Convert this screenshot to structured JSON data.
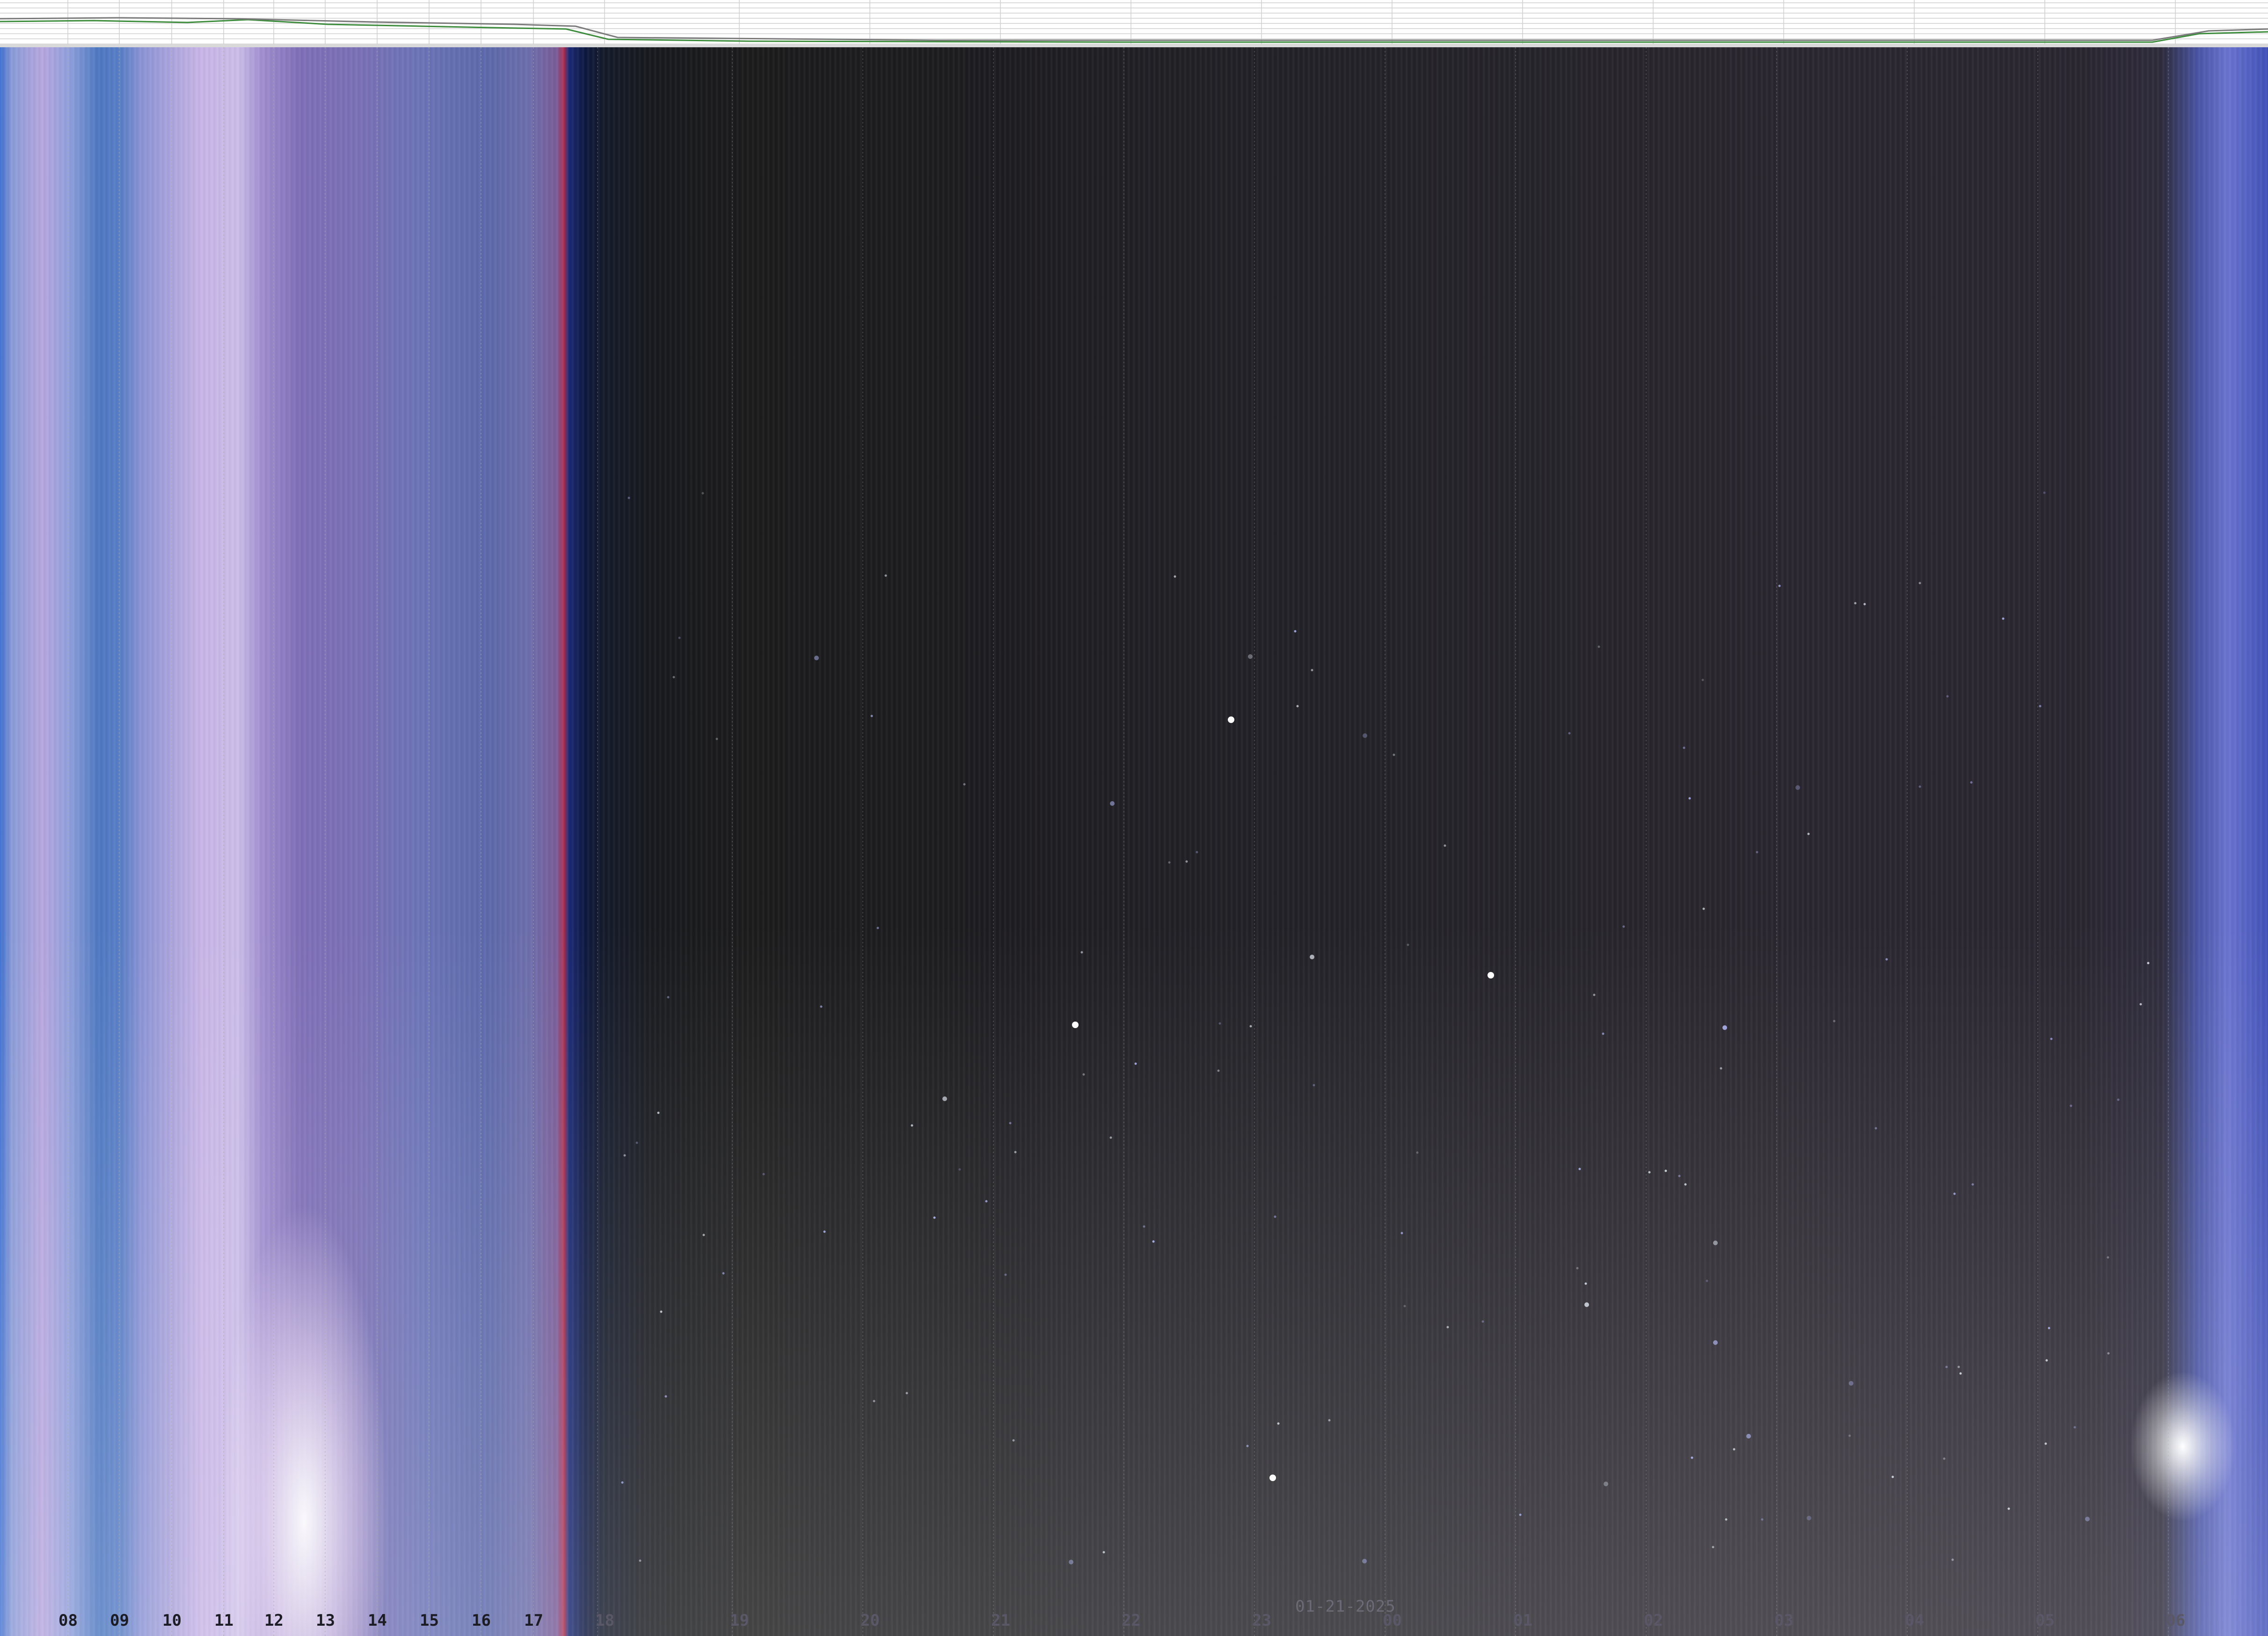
{
  "keogram": {
    "hour_labels": [
      "08",
      "09",
      "10",
      "11",
      "12",
      "13",
      "14",
      "15",
      "16",
      "17",
      "18",
      "19",
      "20",
      "21",
      "22",
      "23",
      "00",
      "01",
      "02",
      "03",
      "04",
      "05",
      "06"
    ],
    "date_label": "01-21-2025",
    "colors": {
      "day_label": "#1c1c24",
      "night_label": "#5a5866",
      "hour_line": "#a9a9a9",
      "strip_background": "#ffffff",
      "strip_grid": "#cfcfcf",
      "strip_line_green": "#3c8c3c",
      "strip_line_gray": "#7a7a7a"
    }
  }
}
